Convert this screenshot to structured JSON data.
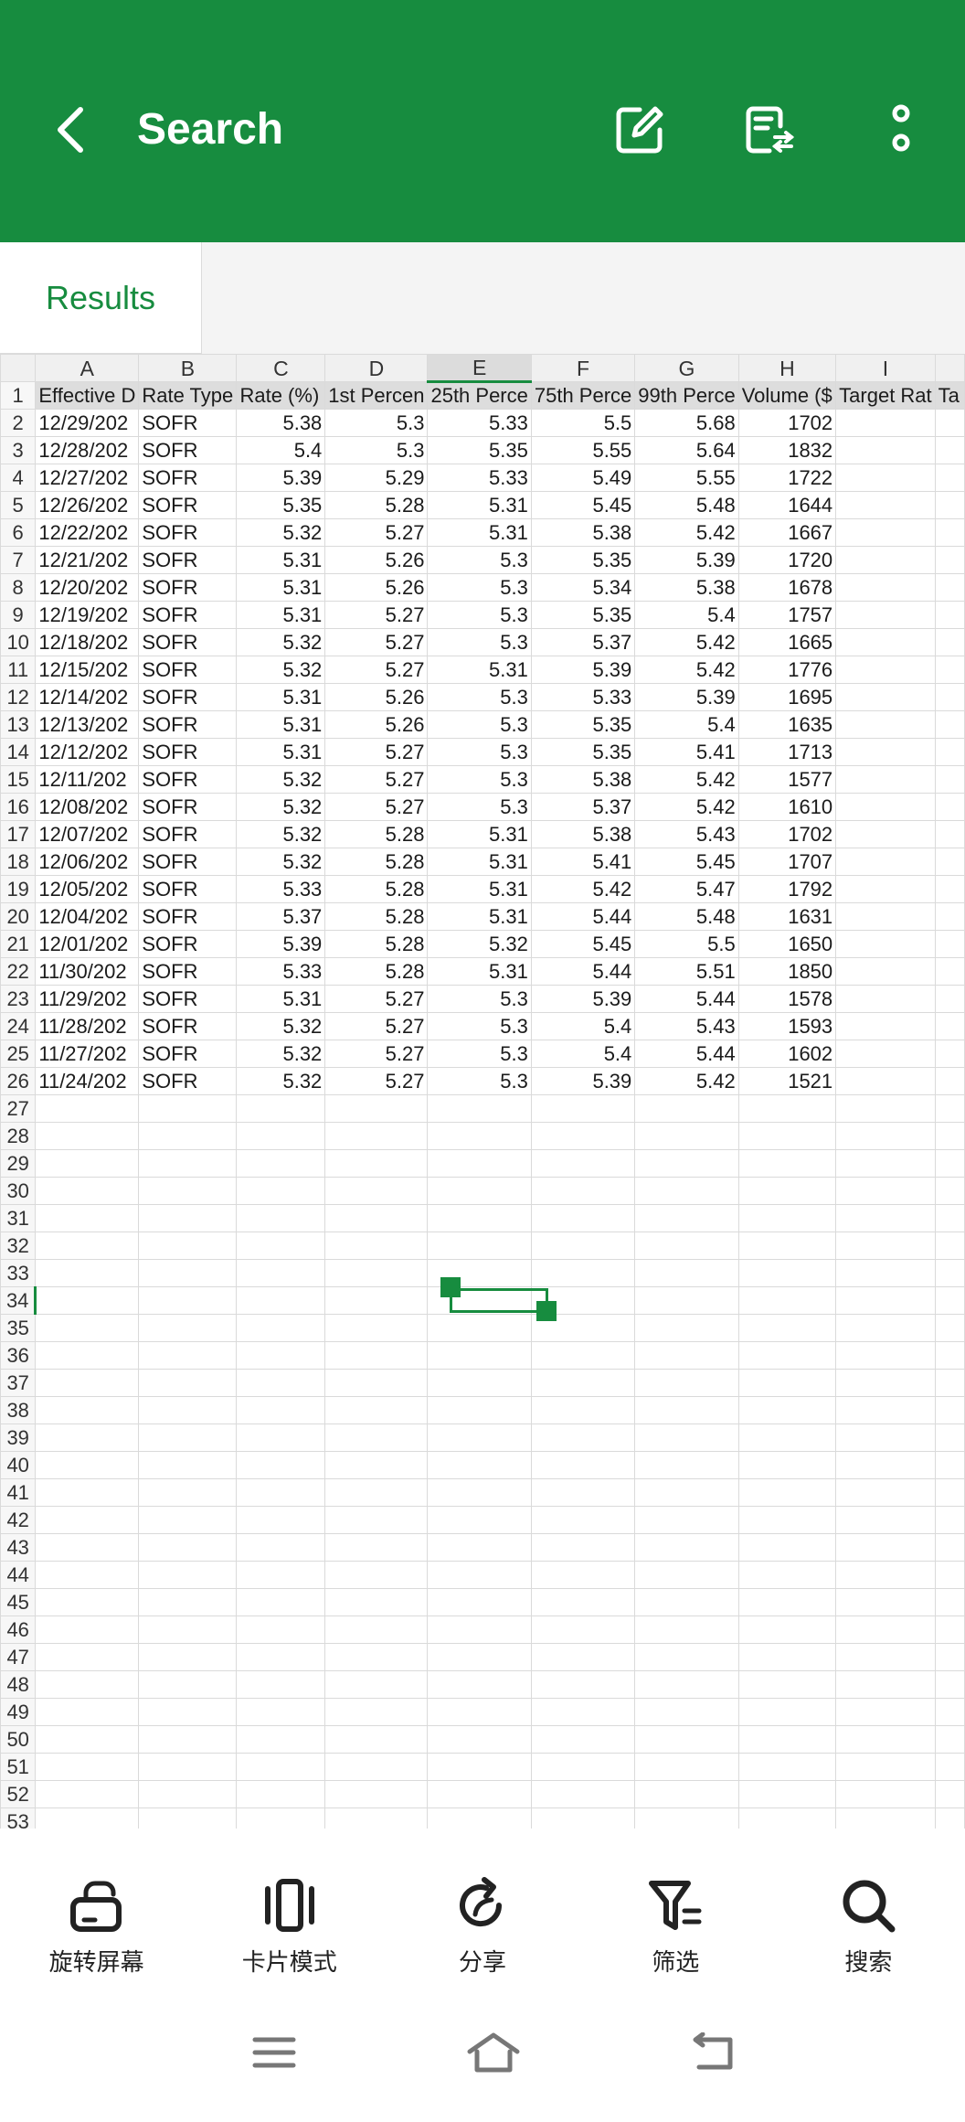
{
  "header": {
    "title": "Search",
    "bg_color": "#178c3f",
    "icons": [
      "back-arrow-icon",
      "edit-icon",
      "document-convert-icon",
      "more-vertical-icon"
    ]
  },
  "tabs": [
    {
      "label": "Results",
      "active": true
    }
  ],
  "sheet": {
    "columns": [
      "A",
      "B",
      "C",
      "D",
      "E",
      "F",
      "G",
      "H",
      "I"
    ],
    "selected_column": "E",
    "selected_row": "34",
    "header_row": [
      "Effective D",
      "Rate Type",
      "Rate (%)",
      "1st Percen",
      "25th Perce",
      "75th Perce",
      "99th Perce",
      "Volume ($",
      "Target Rat",
      "Ta"
    ],
    "rows": [
      [
        "12/29/202",
        "SOFR",
        "5.38",
        "5.3",
        "5.33",
        "5.5",
        "5.68",
        "1702"
      ],
      [
        "12/28/202",
        "SOFR",
        "5.4",
        "5.3",
        "5.35",
        "5.55",
        "5.64",
        "1832"
      ],
      [
        "12/27/202",
        "SOFR",
        "5.39",
        "5.29",
        "5.33",
        "5.49",
        "5.55",
        "1722"
      ],
      [
        "12/26/202",
        "SOFR",
        "5.35",
        "5.28",
        "5.31",
        "5.45",
        "5.48",
        "1644"
      ],
      [
        "12/22/202",
        "SOFR",
        "5.32",
        "5.27",
        "5.31",
        "5.38",
        "5.42",
        "1667"
      ],
      [
        "12/21/202",
        "SOFR",
        "5.31",
        "5.26",
        "5.3",
        "5.35",
        "5.39",
        "1720"
      ],
      [
        "12/20/202",
        "SOFR",
        "5.31",
        "5.26",
        "5.3",
        "5.34",
        "5.38",
        "1678"
      ],
      [
        "12/19/202",
        "SOFR",
        "5.31",
        "5.27",
        "5.3",
        "5.35",
        "5.4",
        "1757"
      ],
      [
        "12/18/202",
        "SOFR",
        "5.32",
        "5.27",
        "5.3",
        "5.37",
        "5.42",
        "1665"
      ],
      [
        "12/15/202",
        "SOFR",
        "5.32",
        "5.27",
        "5.31",
        "5.39",
        "5.42",
        "1776"
      ],
      [
        "12/14/202",
        "SOFR",
        "5.31",
        "5.26",
        "5.3",
        "5.33",
        "5.39",
        "1695"
      ],
      [
        "12/13/202",
        "SOFR",
        "5.31",
        "5.26",
        "5.3",
        "5.35",
        "5.4",
        "1635"
      ],
      [
        "12/12/202",
        "SOFR",
        "5.31",
        "5.27",
        "5.3",
        "5.35",
        "5.41",
        "1713"
      ],
      [
        "12/11/202",
        "SOFR",
        "5.32",
        "5.27",
        "5.3",
        "5.38",
        "5.42",
        "1577"
      ],
      [
        "12/08/202",
        "SOFR",
        "5.32",
        "5.27",
        "5.3",
        "5.37",
        "5.42",
        "1610"
      ],
      [
        "12/07/202",
        "SOFR",
        "5.32",
        "5.28",
        "5.31",
        "5.38",
        "5.43",
        "1702"
      ],
      [
        "12/06/202",
        "SOFR",
        "5.32",
        "5.28",
        "5.31",
        "5.41",
        "5.45",
        "1707"
      ],
      [
        "12/05/202",
        "SOFR",
        "5.33",
        "5.28",
        "5.31",
        "5.42",
        "5.47",
        "1792"
      ],
      [
        "12/04/202",
        "SOFR",
        "5.37",
        "5.28",
        "5.31",
        "5.44",
        "5.48",
        "1631"
      ],
      [
        "12/01/202",
        "SOFR",
        "5.39",
        "5.28",
        "5.32",
        "5.45",
        "5.5",
        "1650"
      ],
      [
        "11/30/202",
        "SOFR",
        "5.33",
        "5.28",
        "5.31",
        "5.44",
        "5.51",
        "1850"
      ],
      [
        "11/29/202",
        "SOFR",
        "5.31",
        "5.27",
        "5.3",
        "5.39",
        "5.44",
        "1578"
      ],
      [
        "11/28/202",
        "SOFR",
        "5.32",
        "5.27",
        "5.3",
        "5.4",
        "5.43",
        "1593"
      ],
      [
        "11/27/202",
        "SOFR",
        "5.32",
        "5.27",
        "5.3",
        "5.4",
        "5.44",
        "1602"
      ],
      [
        "11/24/202",
        "SOFR",
        "5.32",
        "5.27",
        "5.3",
        "5.39",
        "5.42",
        "1521"
      ]
    ],
    "row_numbers": [
      "1",
      "2",
      "3",
      "4",
      "5",
      "6",
      "7",
      "8",
      "9",
      "10",
      "11",
      "12",
      "13",
      "14",
      "15",
      "16",
      "17",
      "18",
      "19",
      "20",
      "21",
      "22",
      "23",
      "24",
      "25",
      "26",
      "27",
      "28",
      "29",
      "30",
      "31",
      "32",
      "33",
      "34",
      "35",
      "36",
      "37",
      "38",
      "39",
      "40",
      "41",
      "42",
      "43",
      "44",
      "45",
      "46",
      "47",
      "48",
      "49",
      "50",
      "51",
      "52",
      "53"
    ]
  },
  "toolbar": {
    "items": [
      {
        "label": "旋转屏幕",
        "icon": "rotate-screen-icon"
      },
      {
        "label": "卡片模式",
        "icon": "card-mode-icon"
      },
      {
        "label": "分享",
        "icon": "share-icon"
      },
      {
        "label": "筛选",
        "icon": "filter-icon"
      },
      {
        "label": "搜索",
        "icon": "search-icon"
      }
    ]
  },
  "navbar": {
    "icons": [
      "menu-icon",
      "home-icon",
      "back-icon"
    ]
  }
}
